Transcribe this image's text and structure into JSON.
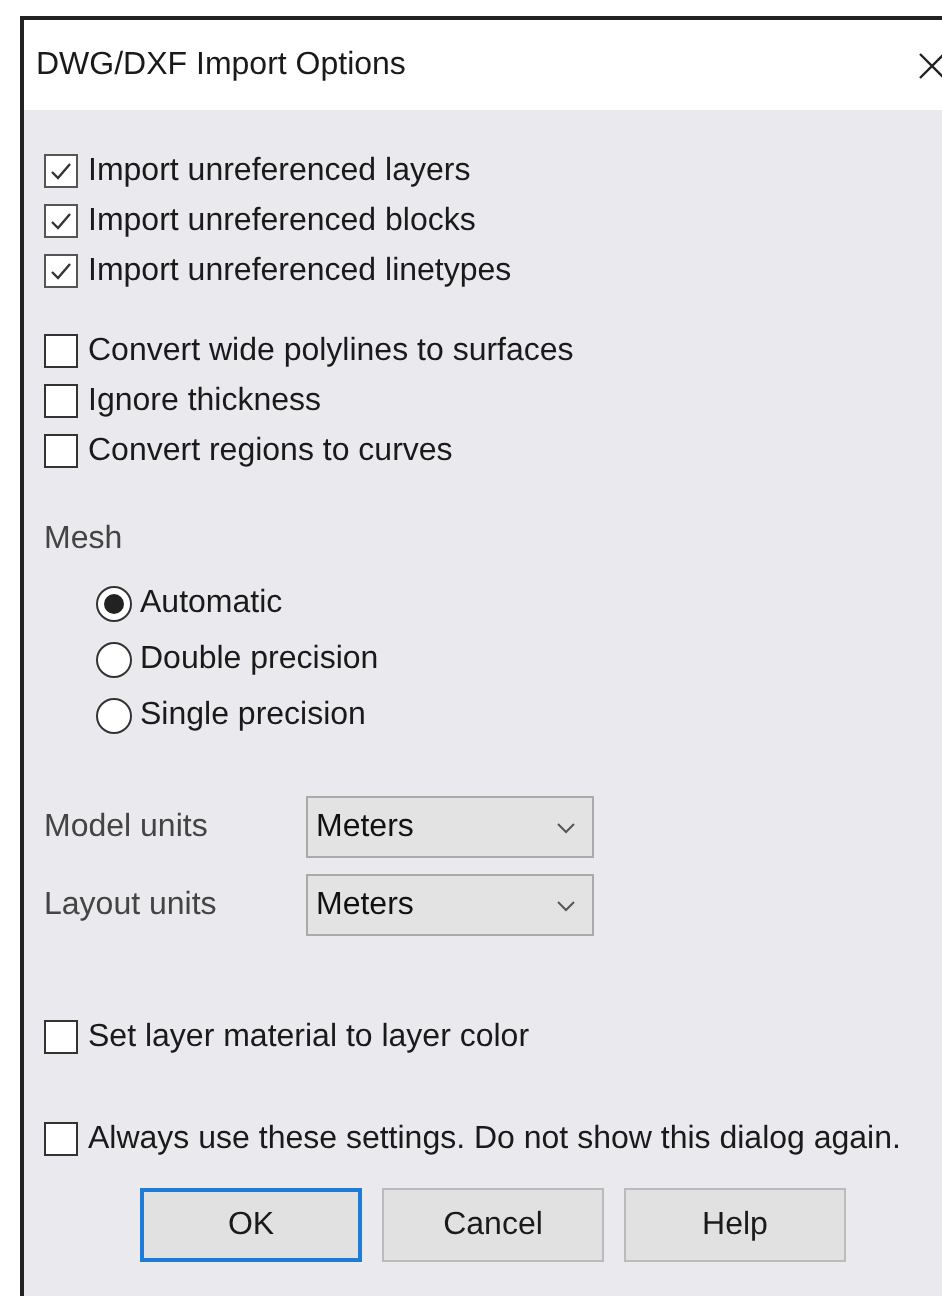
{
  "window": {
    "title": "DWG/DXF Import Options"
  },
  "option_groups": [
    [
      {
        "label": "Import unreferenced layers",
        "checked": true
      },
      {
        "label": "Import unreferenced blocks",
        "checked": true
      },
      {
        "label": "Import unreferenced linetypes",
        "checked": true
      }
    ],
    [
      {
        "label": "Convert wide polylines to surfaces",
        "checked": false
      },
      {
        "label": "Ignore thickness",
        "checked": false
      },
      {
        "label": "Convert regions to curves",
        "checked": false
      }
    ]
  ],
  "mesh": {
    "label": "Mesh",
    "options": [
      {
        "label": "Automatic",
        "selected": true
      },
      {
        "label": "Double precision",
        "selected": false
      },
      {
        "label": "Single precision",
        "selected": false
      }
    ]
  },
  "units": [
    {
      "label": "Model units",
      "value": "Meters"
    },
    {
      "label": "Layout units",
      "value": "Meters"
    }
  ],
  "layer_material": {
    "label": "Set layer material to layer color",
    "checked": false
  },
  "always_use": {
    "label": "Always use these settings. Do not show this dialog again.",
    "checked": false
  },
  "buttons": [
    {
      "label": "OK",
      "focused": true
    },
    {
      "label": "Cancel",
      "focused": false
    },
    {
      "label": "Help",
      "focused": false
    }
  ]
}
